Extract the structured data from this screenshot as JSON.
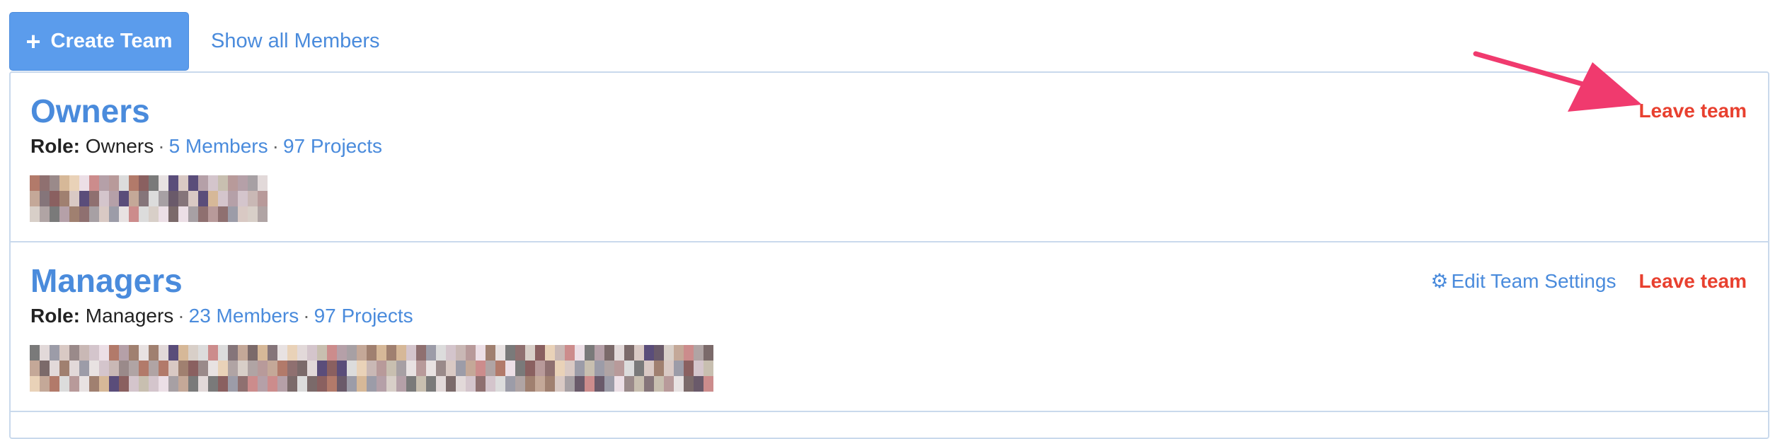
{
  "toolbar": {
    "create_label": "Create Team",
    "show_all_label": "Show all Members",
    "create_color": "#5b9cec"
  },
  "teams": [
    {
      "name": "Owners",
      "role_label": "Role:",
      "role_value": "Owners",
      "members_link": "5 Members",
      "projects_link": "97 Projects",
      "actions": {
        "leave": "Leave team"
      },
      "avatar_count": 8
    },
    {
      "name": "Managers",
      "role_label": "Role:",
      "role_value": "Managers",
      "members_link": "23 Members",
      "projects_link": "97 Projects",
      "actions": {
        "edit": "Edit Team Settings",
        "leave": "Leave team"
      },
      "avatar_count": 23
    }
  ],
  "colors": {
    "link": "#4a8bdc",
    "danger": "#e8402f",
    "arrow": "#f03a6e",
    "border": "#c9d9ec"
  },
  "icons": {
    "create": "plus-icon",
    "edit": "gear-icon",
    "annotation": "arrow-annotation"
  }
}
